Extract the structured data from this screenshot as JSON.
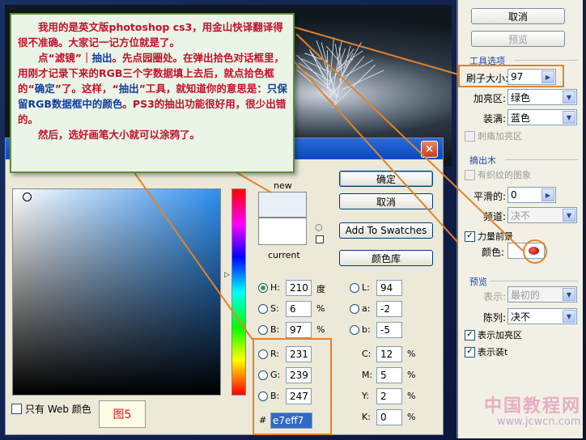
{
  "note": {
    "p1": "我用的是英文版photoshop cs3，用金山快译翻译得很不准确。大家记一记方位就是了。",
    "p2a": "点“滤镜”｜",
    "p2b": "抽出",
    "p2c": "。先点园圈处。在弹出拾色对话框里，用刚才记录下来的RGB三个字数据填上去后，就点拾色框的“",
    "p2d": "确定",
    "p2e": "”了。这样，“",
    "p2f": "抽出",
    "p2g": "”工具，就知道你的意思是：",
    "p2h": "只保留RGB数据框中的颜色",
    "p2i": "。PS3的抽出功能很好用，很少出错的。",
    "p3": "然后，选好画笔大小就可以涂鸦了。"
  },
  "panel": {
    "cancel": "取消",
    "preview": "预览",
    "tool_options_title": "工具选项",
    "brush_size_label": "刷子大小:",
    "brush_size_value": "97",
    "highlight_label": "加亮区:",
    "highlight_value": "绿色",
    "fill_label": "装满:",
    "fill_value": "蓝色",
    "smart_highlight": "刺痛加亮区",
    "extract_title": "摘出木",
    "textured": "有织纹的图象",
    "smooth_label": "平滑的:",
    "smooth_value": "0",
    "channel_label": "频道:",
    "channel_value": "决不",
    "force_fg": "力量前景",
    "color_label": "颜色:",
    "preview_title": "预览",
    "show_label": "表示:",
    "show_value": "最初的",
    "display_label": "陈列:",
    "display_value": "决不",
    "show_highlight": "表示加亮区",
    "show_fill": "表示装t"
  },
  "picker": {
    "new_label": "new",
    "current_label": "current",
    "ok": "确定",
    "cancel": "取消",
    "add_swatches": "Add To Swatches",
    "libraries": "颜色库",
    "h_label": "H:",
    "h_value": "210",
    "h_unit": "度",
    "s_label": "S:",
    "s_value": "6",
    "s_unit": "%",
    "b_label": "B:",
    "b_value": "97",
    "b_unit": "%",
    "l_label": "L:",
    "l_value": "94",
    "a_label": "a:",
    "a_value": "-2",
    "b2_label": "b:",
    "b2_value": "-5",
    "r_label": "R:",
    "r_value": "231",
    "g_label": "G:",
    "g_value": "239",
    "bb_label": "B:",
    "bb_value": "247",
    "c_label": "C:",
    "c_value": "12",
    "c_unit": "%",
    "m_label": "M:",
    "m_value": "5",
    "m_unit": "%",
    "y_label": "Y:",
    "y_value": "2",
    "y_unit": "%",
    "k_label": "K:",
    "k_value": "0",
    "k_unit": "%",
    "hex_label": "#",
    "hex_value": "e7eff7",
    "web_only": "只有 Web 颜色",
    "new_color": "#e7eff7",
    "current_color": "#ffffff"
  },
  "figure_label": "图5",
  "watermark": {
    "line1": "中国教程网",
    "line2": "www.jcwcn.com"
  },
  "colors": {
    "highlight": "#e2832b",
    "note_red": "#c4102b",
    "note_blue": "#123c9c"
  }
}
